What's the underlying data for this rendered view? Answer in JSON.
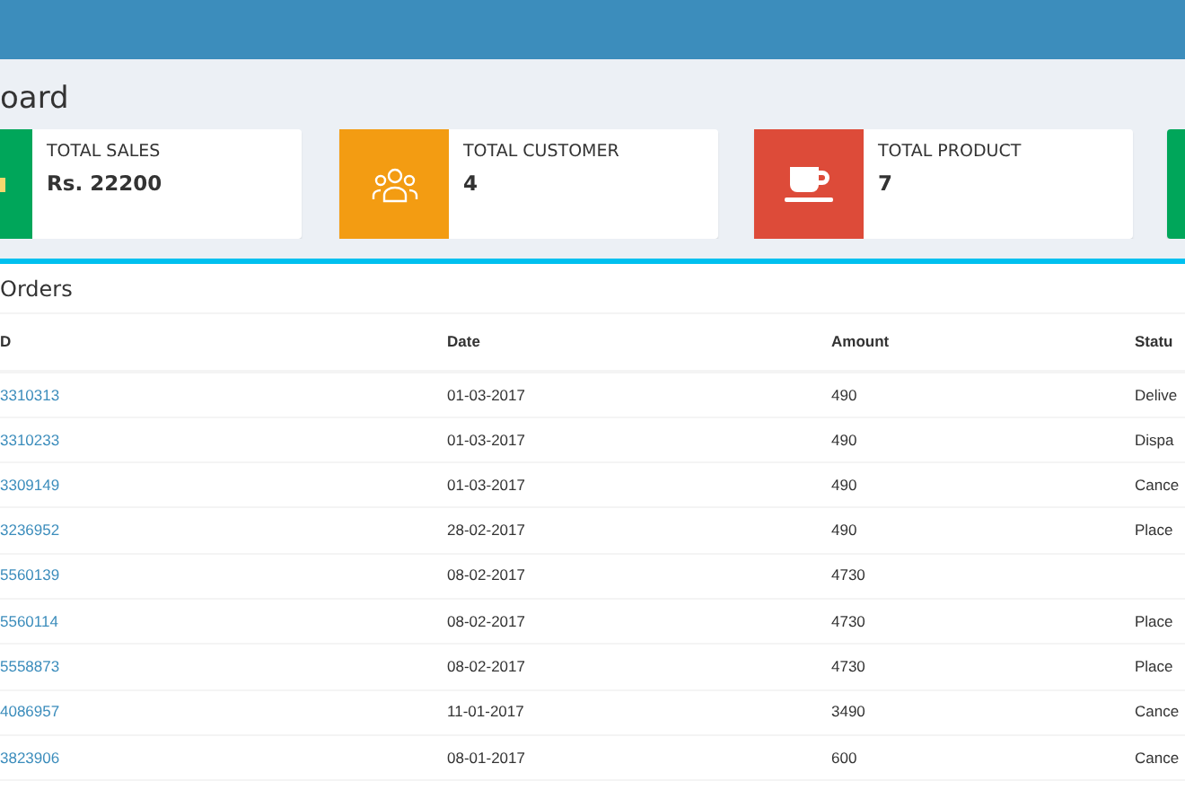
{
  "page_title": "oard",
  "info_boxes": [
    {
      "color": "#00a65a",
      "label": "TOTAL SALES",
      "value": "Rs. 22200"
    },
    {
      "color": "#f39c12",
      "label": "TOTAL CUSTOMER",
      "value": "4"
    },
    {
      "color": "#dd4b39",
      "label": "TOTAL PRODUCT",
      "value": "7"
    },
    {
      "color": "#00a65a"
    }
  ],
  "orders": {
    "title": "Orders",
    "columns": [
      "D",
      "Date",
      "Amount",
      "Statu"
    ],
    "rows": [
      {
        "id": "3310313",
        "date": "01-03-2017",
        "amount": "490",
        "status": "Delive"
      },
      {
        "id": "3310233",
        "date": "01-03-2017",
        "amount": "490",
        "status": "Dispa"
      },
      {
        "id": "3309149",
        "date": "01-03-2017",
        "amount": "490",
        "status": "Cance"
      },
      {
        "id": "3236952",
        "date": "28-02-2017",
        "amount": "490",
        "status": "Place"
      },
      {
        "id": "5560139",
        "date": "08-02-2017",
        "amount": "4730"
      },
      {
        "id": "5560114",
        "date": "08-02-2017",
        "amount": "4730",
        "status": "Place"
      },
      {
        "id": "5558873",
        "date": "08-02-2017",
        "amount": "4730",
        "status": "Place"
      },
      {
        "id": "4086957",
        "date": "11-01-2017",
        "amount": "3490",
        "status": "Cance"
      },
      {
        "id": "3823906",
        "date": "08-01-2017",
        "amount": "600",
        "status": "Cance"
      }
    ]
  }
}
